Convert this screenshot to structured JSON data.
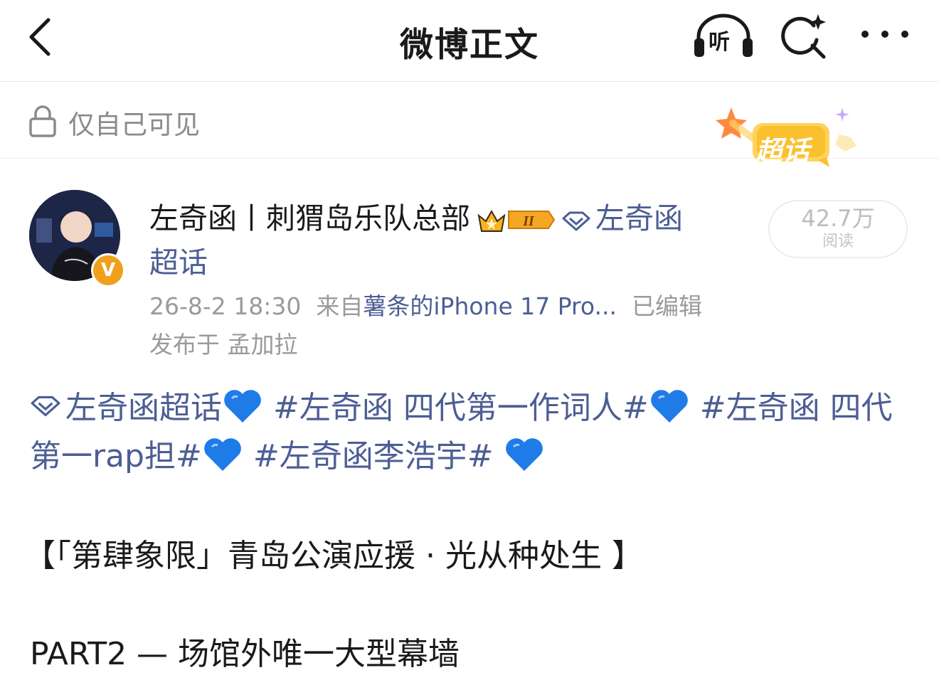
{
  "header": {
    "title": "微博正文",
    "listen_label": "听",
    "back_icon": "chevron-left-icon",
    "search_icon": "search-sparkle-icon",
    "more_icon": "more-dots-icon"
  },
  "visibility": {
    "label": "仅自己可见",
    "icon": "lock-icon",
    "badge_text": "超话"
  },
  "post": {
    "author_name": "左奇函丨刺猬岛乐队总部",
    "member_level": "II",
    "supertopic_link_line1": "左奇函",
    "supertopic_link_line2": "超话",
    "read_count": "42.7万",
    "read_label": "阅读",
    "timestamp": "26-8-2 18:30",
    "source_prefix": "来自",
    "source_device": "薯条的iPhone 17 Pro...",
    "edited_label": "已编辑",
    "location_prefix": "发布于",
    "location": "孟加拉",
    "verified_badge": "V",
    "content": {
      "topic1": "左奇函超话",
      "topic2": "#左奇函 四代第一作词人#",
      "topic3": "#左奇函 四代第一rap担#",
      "topic4": "#左奇函李浩宇#",
      "heading": "【「第肆象限」青岛公演应援 · 光从种处生 】",
      "part": "PART2 — 场馆外唯一大型幕墙"
    }
  },
  "colors": {
    "link": "#4c5e94",
    "muted": "#9a9a9a",
    "heart": "#1e7be8",
    "badge_orange": "#f5b321"
  }
}
